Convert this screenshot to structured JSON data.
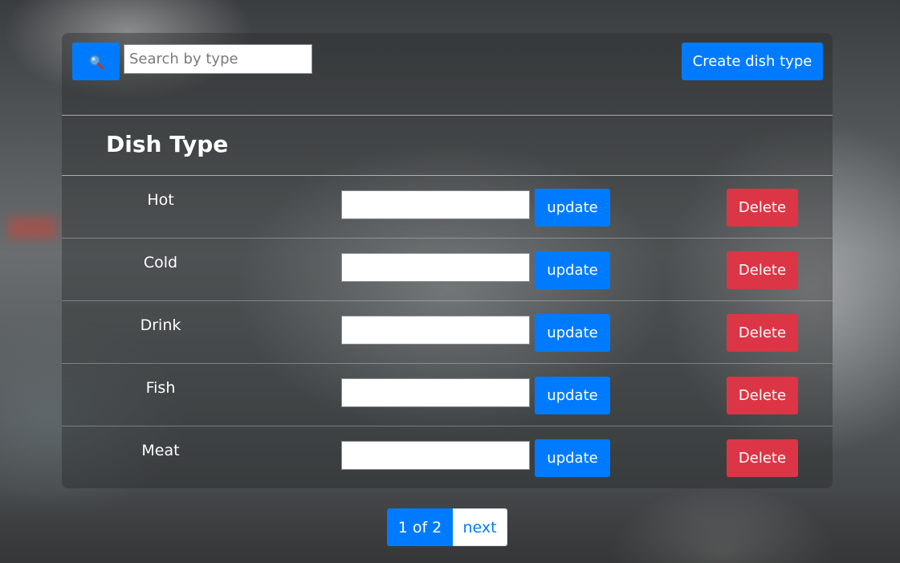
{
  "toolbar": {
    "search_placeholder": "Search by type",
    "search_value": "",
    "search_icon": "magnifier-icon",
    "create_label": "Create dish type"
  },
  "table": {
    "header": "Dish Type",
    "rows": [
      {
        "name": "Hot",
        "input_value": "",
        "update_label": "update",
        "delete_label": "Delete"
      },
      {
        "name": "Cold",
        "input_value": "",
        "update_label": "update",
        "delete_label": "Delete"
      },
      {
        "name": "Drink",
        "input_value": "",
        "update_label": "update",
        "delete_label": "Delete"
      },
      {
        "name": "Fish",
        "input_value": "",
        "update_label": "update",
        "delete_label": "Delete"
      },
      {
        "name": "Meat",
        "input_value": "",
        "update_label": "update",
        "delete_label": "Delete"
      }
    ]
  },
  "pagination": {
    "current": "1 of 2",
    "next_label": "next"
  },
  "colors": {
    "primary": "#007bff",
    "danger": "#dc3545"
  }
}
